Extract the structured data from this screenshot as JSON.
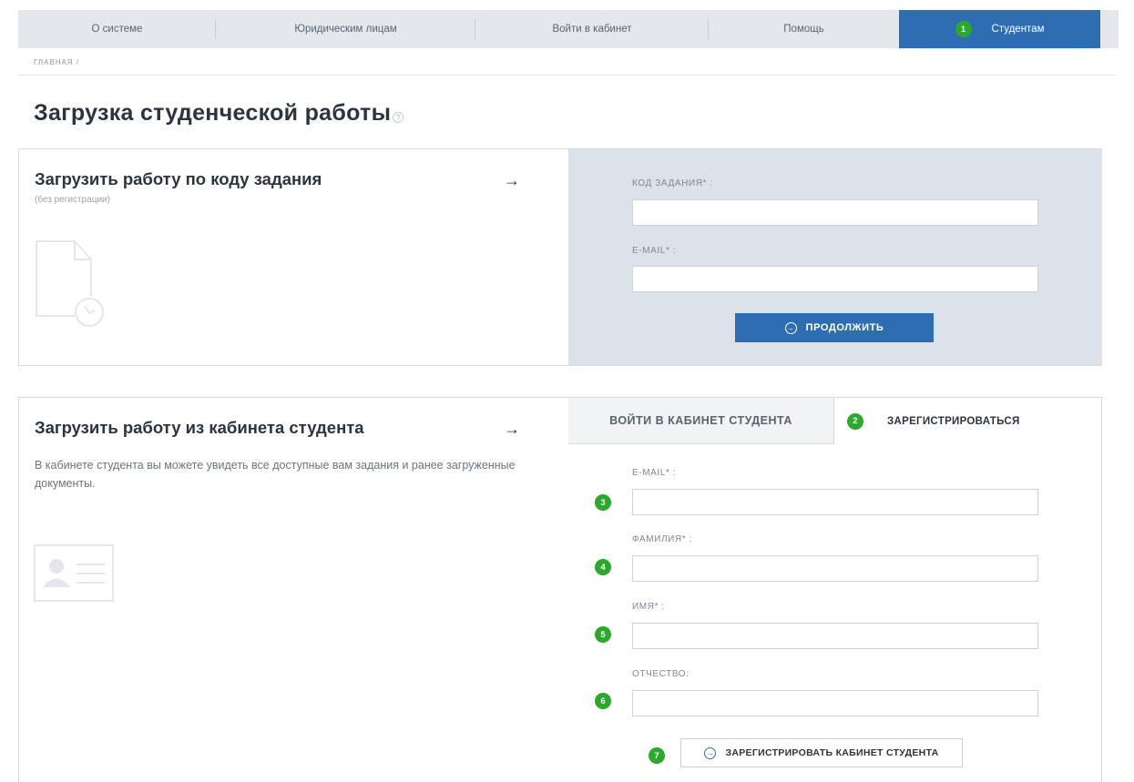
{
  "nav": {
    "items": [
      {
        "label": "О системе"
      },
      {
        "label": "Юридическим лицам"
      },
      {
        "label": "Войти в кабинет"
      },
      {
        "label": "Помощь"
      },
      {
        "label": "Студентам",
        "badge": "1"
      }
    ]
  },
  "breadcrumb": "ГЛАВНАЯ /",
  "page": {
    "title": "Загрузка студенческой работы",
    "help_glyph": "?"
  },
  "code_panel": {
    "title": "Загрузить работу по коду задания",
    "subtitle": "(без регистрации)",
    "arrow": "→",
    "code_label": "КОД ЗАДАНИЯ* :",
    "code_value": "",
    "email_label": "E-MAIL* :",
    "email_value": "",
    "continue_label": "ПРОДОЛЖИТЬ",
    "icon": "document-download-icon"
  },
  "cabinet_panel": {
    "title": "Загрузить работу из кабинета студента",
    "arrow": "→",
    "description": "В кабинете студента вы можете увидеть все доступные вам задания и ранее загруженные документы.",
    "icon": "id-card-icon",
    "tabs": {
      "login": "ВОЙТИ В КАБИНЕТ СТУДЕНТА",
      "register": "ЗАРЕГИСТРИРОВАТЬСЯ",
      "register_badge": "2"
    },
    "fields": [
      {
        "label": "E-MAIL* :",
        "badge": "3",
        "value": ""
      },
      {
        "label": "ФАМИЛИЯ* :",
        "badge": "4",
        "value": ""
      },
      {
        "label": "ИМЯ* :",
        "badge": "5",
        "value": ""
      },
      {
        "label": "ОТЧЕСТВО:",
        "badge": "6",
        "value": ""
      }
    ],
    "register_button": {
      "label": "ЗАРЕГИСТРИРОВАТЬ КАБИНЕТ СТУДЕНТА",
      "badge": "7"
    }
  },
  "colors": {
    "accent": "#2e6db1",
    "badge": "#2aa92a",
    "panel_bg": "#dbe2ea",
    "nav_bg": "#e4e7ec"
  }
}
